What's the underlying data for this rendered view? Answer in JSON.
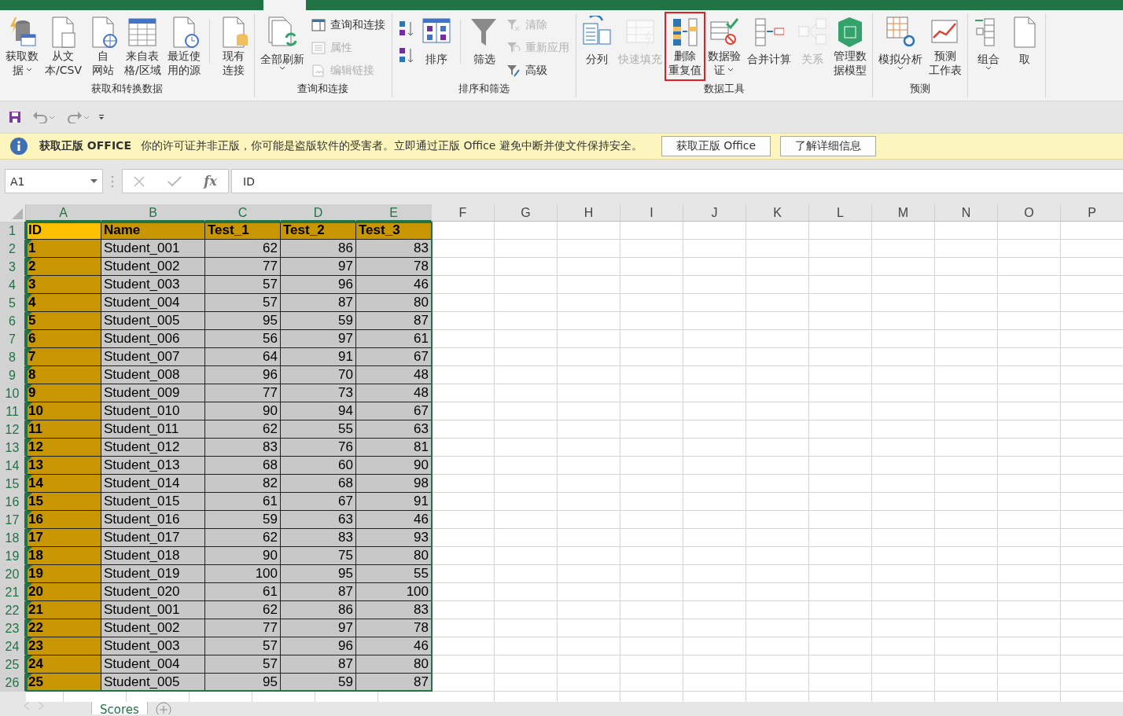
{
  "ribbon": {
    "groups": [
      {
        "label": "获取和转换数据",
        "items": [
          {
            "kind": "large",
            "lines": [
              "获取数",
              "据"
            ],
            "dropdown": true,
            "disabled": false,
            "highlighted": false
          },
          {
            "kind": "large",
            "lines": [
              "从文",
              "本/CSV"
            ],
            "dropdown": false,
            "disabled": false,
            "highlighted": false
          },
          {
            "kind": "large",
            "lines": [
              "自",
              "网站"
            ],
            "dropdown": false,
            "disabled": false,
            "highlighted": false
          },
          {
            "kind": "large",
            "lines": [
              "来自表",
              "格/区域"
            ],
            "dropdown": false,
            "disabled": false,
            "highlighted": false
          },
          {
            "kind": "large",
            "lines": [
              "最近使",
              "用的源"
            ],
            "dropdown": false,
            "disabled": false,
            "highlighted": false
          },
          {
            "kind": "separator"
          },
          {
            "kind": "large",
            "lines": [
              "现有",
              "连接"
            ],
            "dropdown": false,
            "disabled": false,
            "highlighted": false
          }
        ]
      },
      {
        "label": "查询和连接",
        "items": [
          {
            "kind": "large",
            "lines": [
              "全部刷新"
            ],
            "dropdown": true,
            "disabled": false,
            "highlighted": false
          },
          {
            "kind": "stack",
            "smalls": [
              {
                "label": "查询和连接",
                "disabled": false
              },
              {
                "label": "属性",
                "disabled": true
              },
              {
                "label": "编辑链接",
                "disabled": true
              }
            ]
          }
        ]
      },
      {
        "label": "排序和筛选",
        "items": [
          {
            "kind": "sortpair"
          },
          {
            "kind": "large",
            "lines": [
              "排序"
            ],
            "dropdown": false,
            "disabled": false,
            "highlighted": false
          },
          {
            "kind": "separator"
          },
          {
            "kind": "large",
            "lines": [
              "筛选"
            ],
            "dropdown": false,
            "disabled": false,
            "highlighted": false
          },
          {
            "kind": "stack",
            "smalls": [
              {
                "label": "清除",
                "disabled": true
              },
              {
                "label": "重新应用",
                "disabled": true
              },
              {
                "label": "高级",
                "disabled": false
              }
            ]
          }
        ]
      },
      {
        "label": "数据工具",
        "items": [
          {
            "kind": "large",
            "lines": [
              "分列"
            ],
            "dropdown": false,
            "disabled": false,
            "highlighted": false
          },
          {
            "kind": "large",
            "lines": [
              "快速填充"
            ],
            "dropdown": false,
            "disabled": true,
            "highlighted": false
          },
          {
            "kind": "large",
            "lines": [
              "删除",
              "重复值"
            ],
            "dropdown": false,
            "disabled": false,
            "highlighted": true
          },
          {
            "kind": "large",
            "lines": [
              "数据验",
              "证"
            ],
            "dropdown": true,
            "disabled": false,
            "highlighted": false
          },
          {
            "kind": "large",
            "lines": [
              "合并计算"
            ],
            "dropdown": false,
            "disabled": false,
            "highlighted": false
          },
          {
            "kind": "large",
            "lines": [
              "关系"
            ],
            "dropdown": false,
            "disabled": true,
            "highlighted": false
          },
          {
            "kind": "large",
            "lines": [
              "管理数",
              "据模型"
            ],
            "dropdown": false,
            "disabled": false,
            "highlighted": false
          }
        ]
      },
      {
        "label": "预测",
        "items": [
          {
            "kind": "large",
            "lines": [
              "模拟分析"
            ],
            "dropdown": true,
            "disabled": false,
            "highlighted": false
          },
          {
            "kind": "large",
            "lines": [
              "预测",
              "工作表"
            ],
            "dropdown": false,
            "disabled": false,
            "highlighted": false
          }
        ]
      },
      {
        "items": [
          {
            "kind": "large",
            "lines": [
              "组合"
            ],
            "dropdown": true,
            "disabled": false,
            "highlighted": false
          },
          {
            "kind": "large",
            "lines": [
              "取"
            ],
            "dropdown": false,
            "disabled": false,
            "highlighted": false
          }
        ]
      }
    ]
  },
  "notice": {
    "title": "获取正版 OFFICE",
    "message": "你的许可证并非正版，你可能是盗版软件的受害者。立即通过正版 Office 避免中断并使文件保持安全。",
    "buttons": [
      "获取正版 Office",
      "了解详细信息"
    ]
  },
  "formula_bar": {
    "name_box": "A1",
    "fx": "fx",
    "value": "ID"
  },
  "grid": {
    "columns": [
      {
        "letter": "A",
        "selected": true
      },
      {
        "letter": "B",
        "selected": true
      },
      {
        "letter": "C",
        "selected": true
      },
      {
        "letter": "D",
        "selected": true
      },
      {
        "letter": "E",
        "selected": true
      },
      {
        "letter": "F",
        "selected": false
      },
      {
        "letter": "G",
        "selected": false
      },
      {
        "letter": "H",
        "selected": false
      },
      {
        "letter": "I",
        "selected": false
      },
      {
        "letter": "J",
        "selected": false
      },
      {
        "letter": "K",
        "selected": false
      },
      {
        "letter": "L",
        "selected": false
      },
      {
        "letter": "M",
        "selected": false
      },
      {
        "letter": "N",
        "selected": false
      },
      {
        "letter": "O",
        "selected": false
      },
      {
        "letter": "P",
        "selected": false
      }
    ],
    "rows": [
      {
        "number": "1",
        "selected": true,
        "kind": "header",
        "active": true,
        "flagged": false,
        "cells": [
          "ID",
          "Name",
          "Test_1",
          "Test_2",
          "Test_3"
        ]
      },
      {
        "number": "2",
        "selected": true,
        "kind": "data",
        "active": false,
        "flagged": true,
        "cells": [
          "1",
          "Student_001",
          "62",
          "86",
          "83"
        ]
      },
      {
        "number": "3",
        "selected": true,
        "kind": "data",
        "active": false,
        "flagged": true,
        "cells": [
          "2",
          "Student_002",
          "77",
          "97",
          "78"
        ]
      },
      {
        "number": "4",
        "selected": true,
        "kind": "data",
        "active": false,
        "flagged": true,
        "cells": [
          "3",
          "Student_003",
          "57",
          "96",
          "46"
        ]
      },
      {
        "number": "5",
        "selected": true,
        "kind": "data",
        "active": false,
        "flagged": true,
        "cells": [
          "4",
          "Student_004",
          "57",
          "87",
          "80"
        ]
      },
      {
        "number": "6",
        "selected": true,
        "kind": "data",
        "active": false,
        "flagged": true,
        "cells": [
          "5",
          "Student_005",
          "95",
          "59",
          "87"
        ]
      },
      {
        "number": "7",
        "selected": true,
        "kind": "data",
        "active": false,
        "flagged": true,
        "cells": [
          "6",
          "Student_006",
          "56",
          "97",
          "61"
        ]
      },
      {
        "number": "8",
        "selected": true,
        "kind": "data",
        "active": false,
        "flagged": true,
        "cells": [
          "7",
          "Student_007",
          "64",
          "91",
          "67"
        ]
      },
      {
        "number": "9",
        "selected": true,
        "kind": "data",
        "active": false,
        "flagged": true,
        "cells": [
          "8",
          "Student_008",
          "96",
          "70",
          "48"
        ]
      },
      {
        "number": "10",
        "selected": true,
        "kind": "data",
        "active": false,
        "flagged": true,
        "cells": [
          "9",
          "Student_009",
          "77",
          "73",
          "48"
        ]
      },
      {
        "number": "11",
        "selected": true,
        "kind": "data",
        "active": false,
        "flagged": true,
        "cells": [
          "10",
          "Student_010",
          "90",
          "94",
          "67"
        ]
      },
      {
        "number": "12",
        "selected": true,
        "kind": "data",
        "active": false,
        "flagged": true,
        "cells": [
          "11",
          "Student_011",
          "62",
          "55",
          "63"
        ]
      },
      {
        "number": "13",
        "selected": true,
        "kind": "data",
        "active": false,
        "flagged": true,
        "cells": [
          "12",
          "Student_012",
          "83",
          "76",
          "81"
        ]
      },
      {
        "number": "14",
        "selected": true,
        "kind": "data",
        "active": false,
        "flagged": true,
        "cells": [
          "13",
          "Student_013",
          "68",
          "60",
          "90"
        ]
      },
      {
        "number": "15",
        "selected": true,
        "kind": "data",
        "active": false,
        "flagged": true,
        "cells": [
          "14",
          "Student_014",
          "82",
          "68",
          "98"
        ]
      },
      {
        "number": "16",
        "selected": true,
        "kind": "data",
        "active": false,
        "flagged": true,
        "cells": [
          "15",
          "Student_015",
          "61",
          "67",
          "91"
        ]
      },
      {
        "number": "17",
        "selected": true,
        "kind": "data",
        "active": false,
        "flagged": true,
        "cells": [
          "16",
          "Student_016",
          "59",
          "63",
          "46"
        ]
      },
      {
        "number": "18",
        "selected": true,
        "kind": "data",
        "active": false,
        "flagged": true,
        "cells": [
          "17",
          "Student_017",
          "62",
          "83",
          "93"
        ]
      },
      {
        "number": "19",
        "selected": true,
        "kind": "data",
        "active": false,
        "flagged": true,
        "cells": [
          "18",
          "Student_018",
          "90",
          "75",
          "80"
        ]
      },
      {
        "number": "20",
        "selected": true,
        "kind": "data",
        "active": false,
        "flagged": true,
        "cells": [
          "19",
          "Student_019",
          "100",
          "95",
          "55"
        ]
      },
      {
        "number": "21",
        "selected": true,
        "kind": "data",
        "active": false,
        "flagged": true,
        "cells": [
          "20",
          "Student_020",
          "61",
          "87",
          "100"
        ]
      },
      {
        "number": "22",
        "selected": true,
        "kind": "data",
        "active": false,
        "flagged": true,
        "cells": [
          "21",
          "Student_001",
          "62",
          "86",
          "83"
        ]
      },
      {
        "number": "23",
        "selected": true,
        "kind": "data",
        "active": false,
        "flagged": true,
        "cells": [
          "22",
          "Student_002",
          "77",
          "97",
          "78"
        ]
      },
      {
        "number": "24",
        "selected": true,
        "kind": "data",
        "active": false,
        "flagged": true,
        "cells": [
          "23",
          "Student_003",
          "57",
          "96",
          "46"
        ]
      },
      {
        "number": "25",
        "selected": true,
        "kind": "data",
        "active": false,
        "flagged": true,
        "cells": [
          "24",
          "Student_004",
          "57",
          "87",
          "80"
        ]
      },
      {
        "number": "26",
        "selected": true,
        "kind": "data",
        "active": false,
        "flagged": true,
        "cells": [
          "25",
          "Student_005",
          "95",
          "59",
          "87"
        ]
      }
    ]
  },
  "sheet_tabs": [
    {
      "label": "Scores",
      "selected": true
    }
  ]
}
